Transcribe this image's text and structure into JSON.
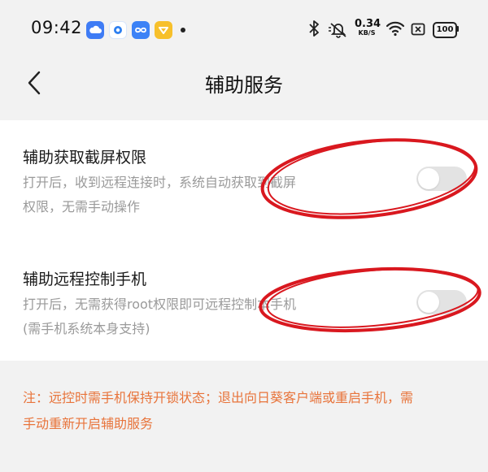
{
  "status_bar": {
    "time": "09:42",
    "net_speed_value": "0.34",
    "net_speed_unit": "KB/S",
    "battery": "100",
    "icons": [
      "cloud-app-icon",
      "camera-app-icon",
      "infinity-app-icon",
      "heart-app-icon",
      "bluetooth-icon",
      "mute-icon",
      "wifi-icon",
      "sim-off-icon"
    ]
  },
  "header": {
    "title": "辅助服务",
    "back_icon": "chevron-left-icon"
  },
  "settings": [
    {
      "title": "辅助获取截屏权限",
      "desc_line1": "打开后，收到远程连接时，系统自动获取到截屏",
      "desc_line2": "权限，无需手动操作",
      "enabled": false
    },
    {
      "title": "辅助远程控制手机",
      "desc_line1": "打开后，无需获得root权限即可远程控制本手机",
      "desc_line2": "(需手机系统本身支持)",
      "enabled": false
    }
  ],
  "note": {
    "line1": "注：远控时需手机保持开锁状态；退出向日葵客户端或重启手机，需",
    "line2": "手动重新开启辅助服务"
  },
  "colors": {
    "background": "#f2f2f2",
    "card": "#ffffff",
    "note": "#e8743b",
    "annotation_circle": "#d9181f",
    "toggle_off": "#e3e3e3"
  }
}
